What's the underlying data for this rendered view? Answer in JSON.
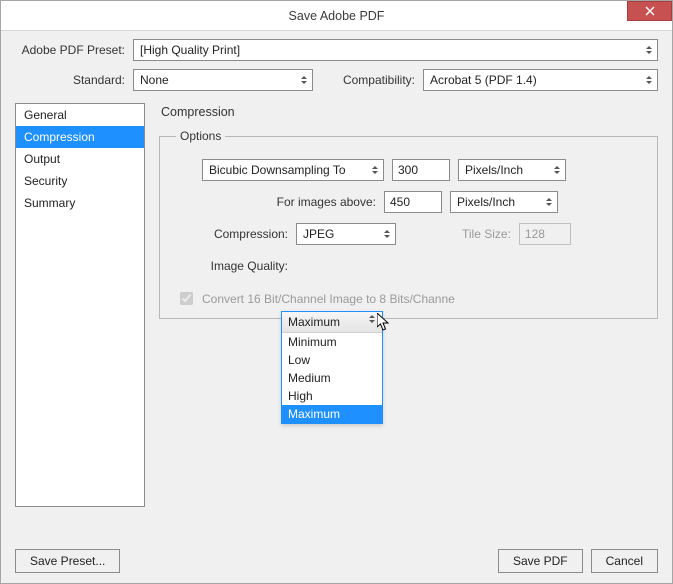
{
  "window": {
    "title": "Save Adobe PDF"
  },
  "header": {
    "preset_label": "Adobe PDF Preset:",
    "preset_value": "[High Quality Print]",
    "standard_label": "Standard:",
    "standard_value": "None",
    "compat_label": "Compatibility:",
    "compat_value": "Acrobat 5 (PDF 1.4)"
  },
  "sidebar": {
    "items": [
      {
        "label": "General"
      },
      {
        "label": "Compression"
      },
      {
        "label": "Output"
      },
      {
        "label": "Security"
      },
      {
        "label": "Summary"
      }
    ],
    "selected_index": 1
  },
  "panel": {
    "title": "Compression",
    "options_legend": "Options",
    "downsample": {
      "method": "Bicubic Downsampling To",
      "value": "300",
      "unit": "Pixels/Inch"
    },
    "above": {
      "label": "For images above:",
      "value": "450",
      "unit": "Pixels/Inch"
    },
    "compression": {
      "label": "Compression:",
      "value": "JPEG"
    },
    "tilesize": {
      "label": "Tile Size:",
      "value": "128"
    },
    "image_quality": {
      "label": "Image Quality:",
      "value": "Maximum",
      "options": [
        "Minimum",
        "Low",
        "Medium",
        "High",
        "Maximum"
      ]
    },
    "convert": {
      "label": "Convert 16 Bit/Channel Image to 8 Bits/Channe",
      "checked": true
    }
  },
  "footer": {
    "save_preset": "Save Preset...",
    "save_pdf": "Save PDF",
    "cancel": "Cancel"
  }
}
